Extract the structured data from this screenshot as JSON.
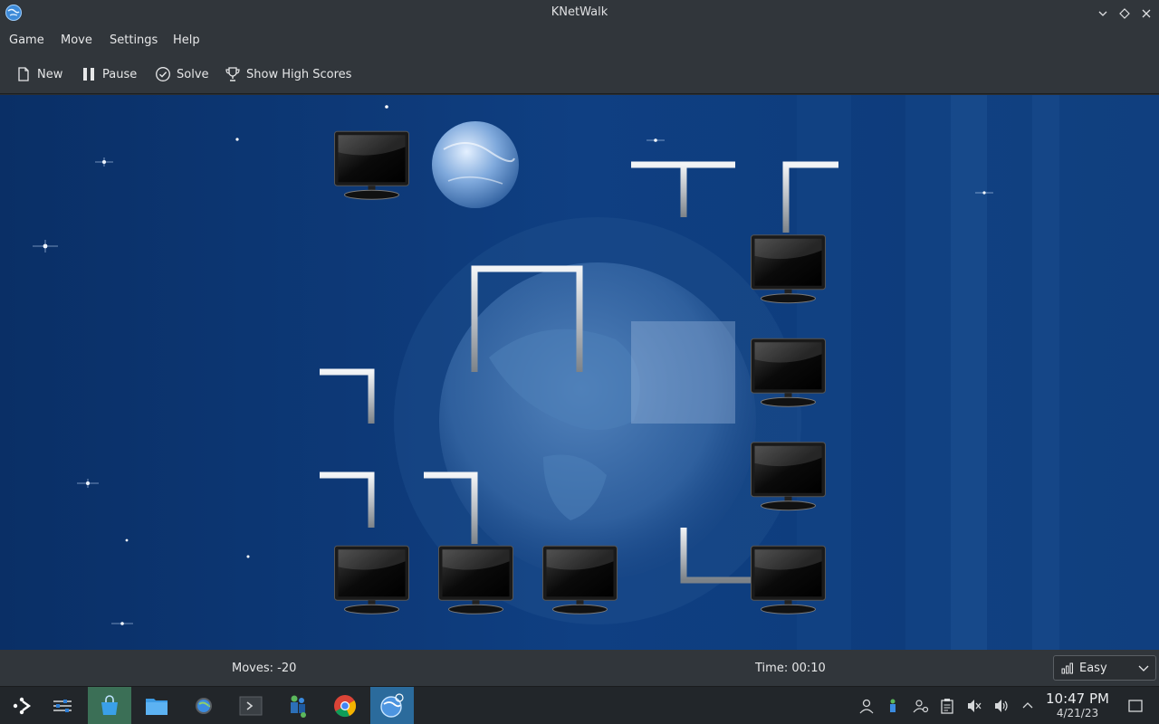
{
  "window": {
    "title": "KNetWalk"
  },
  "menu": {
    "game": "Game",
    "move": "Move",
    "settings": "Settings",
    "help": "Help"
  },
  "toolbar": {
    "new": "New",
    "pause": "Pause",
    "solve": "Solve",
    "high_scores": "Show High Scores"
  },
  "status": {
    "moves": "Moves: -20",
    "time": "Time: 00:10",
    "difficulty": "Easy"
  },
  "board": {
    "cols": 5,
    "rows": 5,
    "cells": [
      [
        "computer",
        "server",
        "pipe",
        "pipe",
        "pipe"
      ],
      [
        "pipe",
        "pipe",
        "pipe",
        "pipe",
        "computer"
      ],
      [
        "pipe",
        "pipe",
        "pipe",
        "pipe",
        "computer"
      ],
      [
        "pipe",
        "pipe",
        "pipe",
        "pipe",
        "computer"
      ],
      [
        "computer",
        "computer",
        "computer",
        "pipe",
        "computer"
      ]
    ],
    "highlighted_cell": "row 3, column 4"
  },
  "taskbar": {
    "apps": [
      "application-launcher-icon",
      "system-settings-icon",
      "discover-store-icon",
      "file-manager-icon",
      "settings-gear-icon",
      "terminal-icon",
      "user-manager-icon",
      "chrome-icon",
      "knetwalk-icon"
    ]
  },
  "clock": {
    "time": "10:47 PM",
    "date": "4/21/23"
  },
  "colors": {
    "board_bg": "#0f3a7a",
    "panel": "#31363b",
    "pipe": "#c8ccd0"
  }
}
